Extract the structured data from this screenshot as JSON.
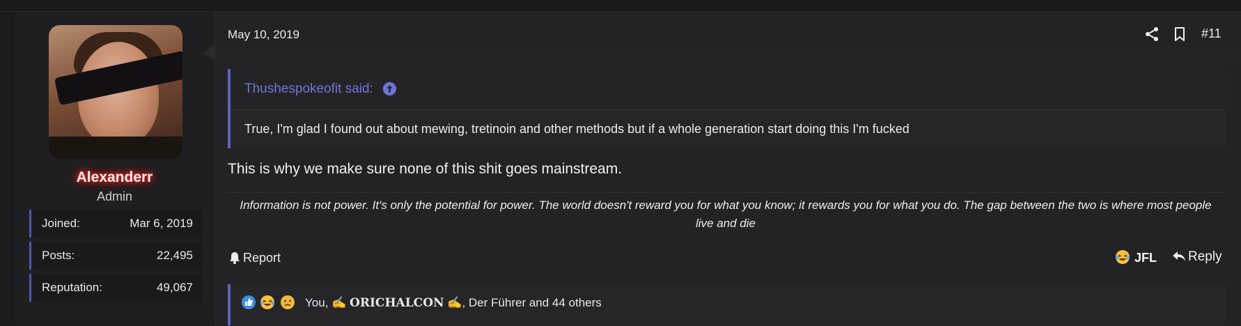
{
  "user": {
    "username": "Alexanderr",
    "title": "Admin",
    "stats": [
      {
        "label": "Joined:",
        "value": "Mar 6, 2019"
      },
      {
        "label": "Posts:",
        "value": "22,495"
      },
      {
        "label": "Reputation:",
        "value": "49,067"
      }
    ]
  },
  "post": {
    "date": "May 10, 2019",
    "number": "#11",
    "quote": {
      "author": "Thushespokeofit said:",
      "text": "True, I'm glad I found out about mewing, tretinoin and other methods but if a whole generation start doing this I'm fucked"
    },
    "text": "This is why we make sure none of this shit goes mainstream.",
    "signature": "Information is not power. It's only the potential for power. The world doesn't reward you for what you know; it rewards you for what you do. The gap between the two is where most people live and die"
  },
  "actions": {
    "report": "Report",
    "jfl": "JFL",
    "reply": "Reply"
  },
  "reactions": {
    "you": "You, ",
    "mark": "✍",
    "name": "ORICHALCON",
    "rest": ", Der Führer and 44 others"
  },
  "colors": {
    "accent": "#5a63c4",
    "link": "#6d76d6",
    "admin_glow": "#ff2b2b"
  },
  "icons": [
    "share-icon",
    "bookmark-icon",
    "arrow-up-circle-icon",
    "bell-icon",
    "laughing-emoji-icon",
    "reply-arrow-icon",
    "like-icon",
    "sad-emoji-icon"
  ]
}
